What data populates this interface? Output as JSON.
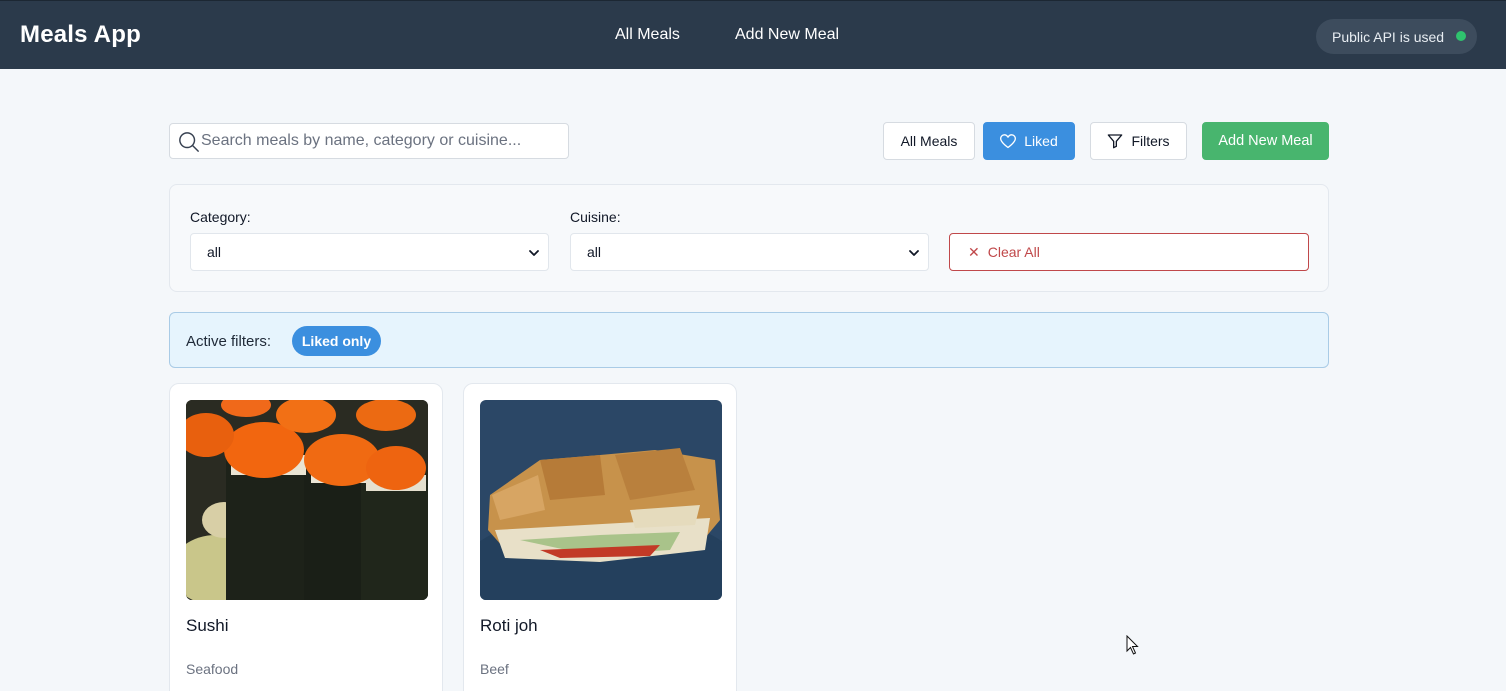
{
  "header": {
    "brand": "Meals App",
    "nav": [
      {
        "label": "All Meals"
      },
      {
        "label": "Add New Meal"
      }
    ],
    "api_status": "Public API is used",
    "api_status_color": "#2fc36e"
  },
  "toolbar": {
    "search_placeholder": "Search meals by name, category or cuisine...",
    "all_meals_label": "All Meals",
    "liked_label": "Liked",
    "filters_label": "Filters",
    "add_new_label": "Add New Meal"
  },
  "filters": {
    "category_label": "Category:",
    "category_value": "all",
    "cuisine_label": "Cuisine:",
    "cuisine_value": "all",
    "clear_label": "Clear All"
  },
  "active_filters": {
    "label": "Active filters:",
    "chips": [
      "Liked only"
    ]
  },
  "meals": [
    {
      "name": "Sushi",
      "category": "Seafood"
    },
    {
      "name": "Roti joh",
      "category": "Beef"
    }
  ],
  "colors": {
    "header_bg": "#2b3a4b",
    "primary": "#3b8fdf",
    "success": "#48b56e",
    "danger": "#c0484a"
  }
}
